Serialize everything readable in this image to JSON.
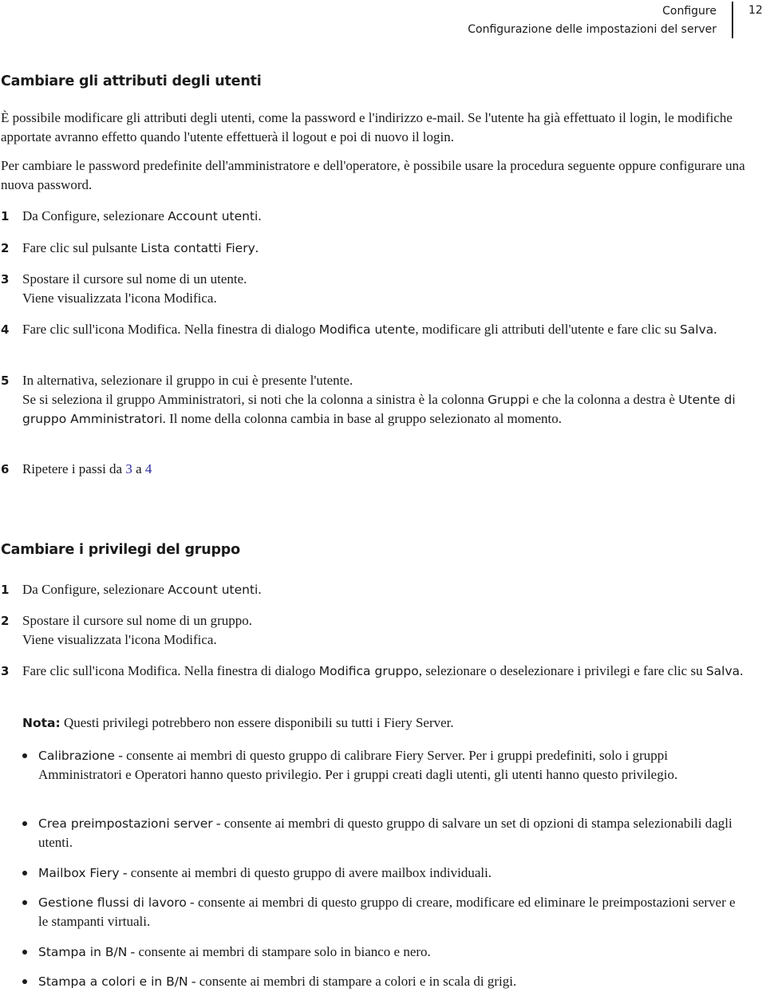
{
  "header": {
    "chapter": "Configure",
    "section": "Configurazione delle impostazioni del server",
    "page_number": "12"
  },
  "section1": {
    "title": "Cambiare gli attributi degli utenti",
    "para1": "È possibile modificare gli attributi degli utenti, come la password e l'indirizzo e-mail. Se l'utente ha già effettuato il login, le modifiche apportate avranno effetto quando l'utente effettuerà il logout e poi di nuovo il login.",
    "para2": "Per cambiare le password predefinite dell'amministratore e dell'operatore, è possibile usare la procedura seguente oppure configurare una nuova password.",
    "steps": [
      {
        "num": "1",
        "text_a": "Da Configure, selezionare ",
        "ui_a": "Account utenti",
        "text_b": "."
      },
      {
        "num": "2",
        "text_a": "Fare clic sul pulsante ",
        "ui_a": "Lista contatti Fiery",
        "text_b": "."
      },
      {
        "num": "3",
        "line1": "Spostare il cursore sul nome di un utente.",
        "line2": "Viene visualizzata l'icona Modifica."
      },
      {
        "num": "4",
        "text_a": "Fare clic sull'icona Modifica. Nella finestra di dialogo ",
        "ui_a": "Modifica utente",
        "text_b": ", modificare gli attributi dell'utente e fare clic su ",
        "ui_b": "Salva",
        "text_c": "."
      },
      {
        "num": "5",
        "line1": "In alternativa, selezionare il gruppo in cui è presente l'utente.",
        "text_a": "Se si seleziona il gruppo Amministratori, si noti che la colonna a sinistra è la colonna ",
        "ui_a": "Gruppi",
        "text_b": " e che la colonna a destra è ",
        "ui_b": "Utente di gruppo Amministratori",
        "text_c": ". Il nome della colonna cambia in base al gruppo selezionato al momento."
      },
      {
        "num": "6",
        "text_a": "Ripetere i passi da ",
        "link_a": "3",
        "text_b": " a ",
        "link_b": "4"
      }
    ]
  },
  "section2": {
    "title": "Cambiare i privilegi del gruppo",
    "steps": [
      {
        "num": "1",
        "text_a": "Da Configure, selezionare ",
        "ui_a": "Account utenti",
        "text_b": "."
      },
      {
        "num": "2",
        "line1": "Spostare il cursore sul nome di un gruppo.",
        "line2": "Viene visualizzata l'icona Modifica."
      },
      {
        "num": "3",
        "text_a": "Fare clic sull'icona Modifica. Nella finestra di dialogo ",
        "ui_a": "Modifica gruppo",
        "text_b": ", selezionare o deselezionare i privilegi e fare clic su ",
        "ui_b": "Salva",
        "text_c": "."
      }
    ],
    "note": {
      "label": "Nota:",
      "text": " Questi privilegi potrebbero non essere disponibili su tutti i Fiery Server."
    },
    "privileges": [
      {
        "name": "Calibrazione",
        "desc": " - consente ai membri di questo gruppo di calibrare Fiery Server. Per i gruppi predefiniti, solo i gruppi Amministratori e Operatori hanno questo privilegio. Per i gruppi creati dagli utenti, gli utenti hanno questo privilegio."
      },
      {
        "name": "Crea preimpostazioni server",
        "desc": " - consente ai membri di questo gruppo di salvare un set di opzioni di stampa selezionabili dagli utenti."
      },
      {
        "name": "Mailbox Fiery",
        "desc": " - consente ai membri di questo gruppo di avere mailbox individuali."
      },
      {
        "name": "Gestione flussi di lavoro",
        "desc": " - consente ai membri di questo gruppo di creare, modificare ed eliminare le preimpostazioni server e le stampanti virtuali."
      },
      {
        "name": "Stampa in B/N",
        "desc": " - consente ai membri di stampare solo in bianco e nero."
      },
      {
        "name": "Stampa a colori e in B/N",
        "desc": " - consente ai membri di stampare a colori e in scala di grigi."
      }
    ]
  },
  "colors": {
    "text": "#1a1a1a",
    "link": "#2a2aa0"
  }
}
